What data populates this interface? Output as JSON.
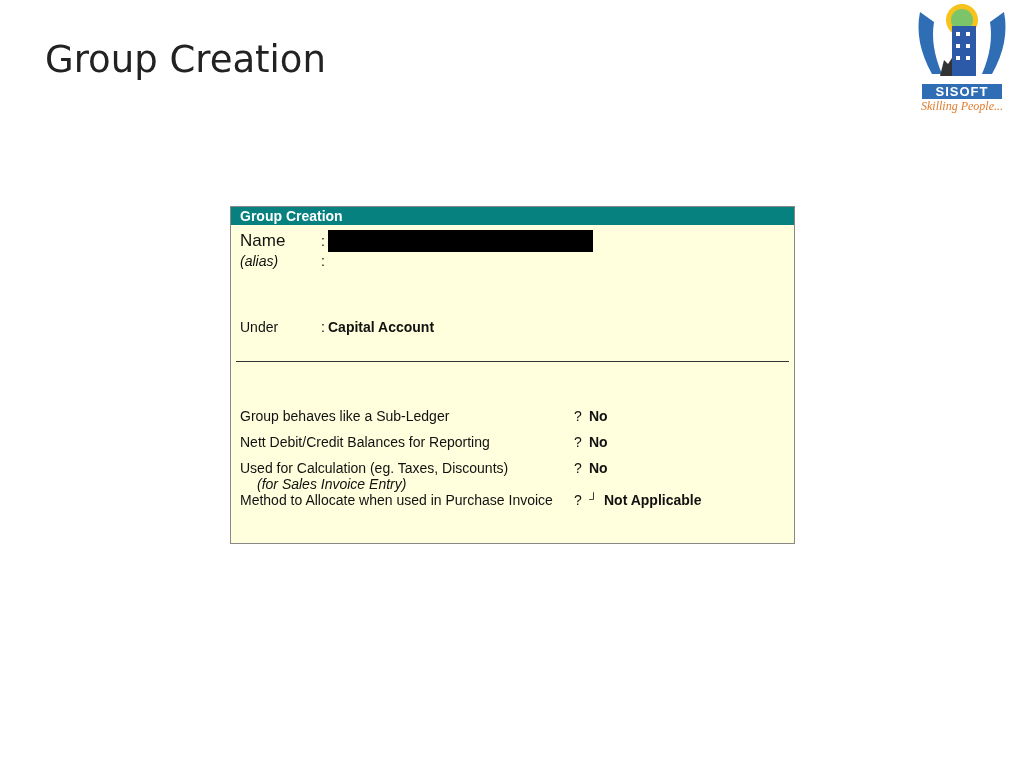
{
  "slide_title": "Group Creation",
  "logo": {
    "name": "SISOFT",
    "tagline": "Skilling People..."
  },
  "form": {
    "title": "Group Creation",
    "fields": [
      {
        "label": "Name",
        "kind": "redacted",
        "separator": ":"
      },
      {
        "label": "(alias)",
        "kind": "alias",
        "separator": ":"
      }
    ],
    "under": {
      "label": "Under",
      "separator": ":",
      "value": "Capital Account"
    },
    "options": [
      {
        "label": "Group behaves like a Sub-Ledger",
        "prompt": "?",
        "value": "No"
      },
      {
        "label": "Nett Debit/Credit Balances for Reporting",
        "prompt": "?",
        "value": "No"
      },
      {
        "label": "Used for Calculation (eg. Taxes, Discounts)",
        "note": "(for Sales Invoice Entry)",
        "prompt": "?",
        "value": "No"
      },
      {
        "label": "Method to Allocate when used in Purchase Invoice",
        "prompt": "?",
        "marker": "┘",
        "value": "Not Applicable"
      }
    ]
  }
}
